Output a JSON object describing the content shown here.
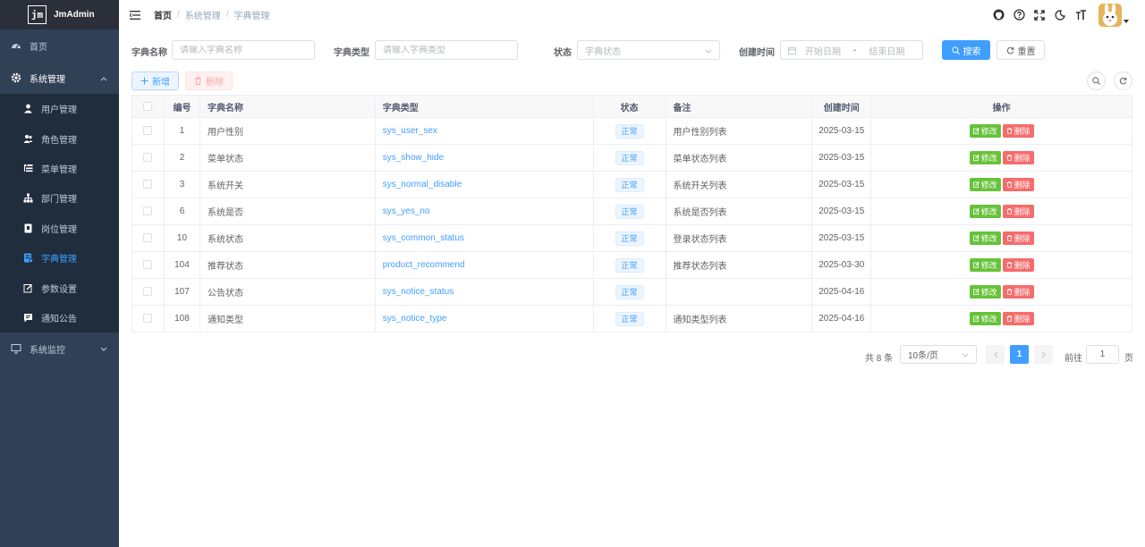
{
  "app": {
    "logo_mark": "jm",
    "name": "JmAdmin"
  },
  "sidebar": {
    "home": "首页",
    "system": "系统管理",
    "sub_items": [
      {
        "label": "用户管理",
        "icon": "user-icon"
      },
      {
        "label": "角色管理",
        "icon": "peoples-icon"
      },
      {
        "label": "菜单管理",
        "icon": "tree-table-icon"
      },
      {
        "label": "部门管理",
        "icon": "tree-icon"
      },
      {
        "label": "岗位管理",
        "icon": "post-icon"
      },
      {
        "label": "字典管理",
        "icon": "dict-icon",
        "active": true
      },
      {
        "label": "参数设置",
        "icon": "edit-icon"
      },
      {
        "label": "通知公告",
        "icon": "message-icon"
      }
    ],
    "monitor": "系统监控"
  },
  "breadcrumb": [
    "首页",
    "系统管理",
    "字典管理"
  ],
  "search": {
    "dict_name_label": "字典名称",
    "dict_name_placeholder": "请输入字典名称",
    "dict_type_label": "字典类型",
    "dict_type_placeholder": "请输入字典类型",
    "status_label": "状态",
    "status_placeholder": "字典状态",
    "created_label": "创建时间",
    "start_placeholder": "开始日期",
    "range_sep": "-",
    "end_placeholder": "结束日期",
    "search_btn": "搜索",
    "reset_btn": "重置"
  },
  "toolbar": {
    "add_btn": "新增",
    "delete_btn": "删除"
  },
  "table": {
    "columns": [
      "编号",
      "字典名称",
      "字典类型",
      "状态",
      "备注",
      "创建时间",
      "操作"
    ],
    "edit_label": "修改",
    "delete_label": "删除",
    "rows": [
      {
        "id": "1",
        "name": "用户性别",
        "type": "sys_user_sex",
        "status": "正常",
        "remark": "用户性别列表",
        "created": "2025-03-15"
      },
      {
        "id": "2",
        "name": "菜单状态",
        "type": "sys_show_hide",
        "status": "正常",
        "remark": "菜单状态列表",
        "created": "2025-03-15"
      },
      {
        "id": "3",
        "name": "系统开关",
        "type": "sys_normal_disable",
        "status": "正常",
        "remark": "系统开关列表",
        "created": "2025-03-15"
      },
      {
        "id": "6",
        "name": "系统是否",
        "type": "sys_yes_no",
        "status": "正常",
        "remark": "系统是否列表",
        "created": "2025-03-15"
      },
      {
        "id": "10",
        "name": "系统状态",
        "type": "sys_common_status",
        "status": "正常",
        "remark": "登录状态列表",
        "created": "2025-03-15"
      },
      {
        "id": "104",
        "name": "推荐状态",
        "type": "product_recommend",
        "status": "正常",
        "remark": "推荐状态列表",
        "created": "2025-03-30"
      },
      {
        "id": "107",
        "name": "公告状态",
        "type": "sys_notice_status",
        "status": "正常",
        "remark": "",
        "created": "2025-04-16"
      },
      {
        "id": "108",
        "name": "通知类型",
        "type": "sys_notice_type",
        "status": "正常",
        "remark": "通知类型列表",
        "created": "2025-04-16"
      }
    ]
  },
  "pagination": {
    "total": "共 8 条",
    "page_size": "10条/页",
    "current_page": "1",
    "goto_label": "前往",
    "goto_value": "1",
    "page_suffix": "页"
  },
  "colors": {
    "primary": "#409eff",
    "success": "#67c23a",
    "danger": "#f56c6c",
    "sidebar_bg": "#304156"
  }
}
